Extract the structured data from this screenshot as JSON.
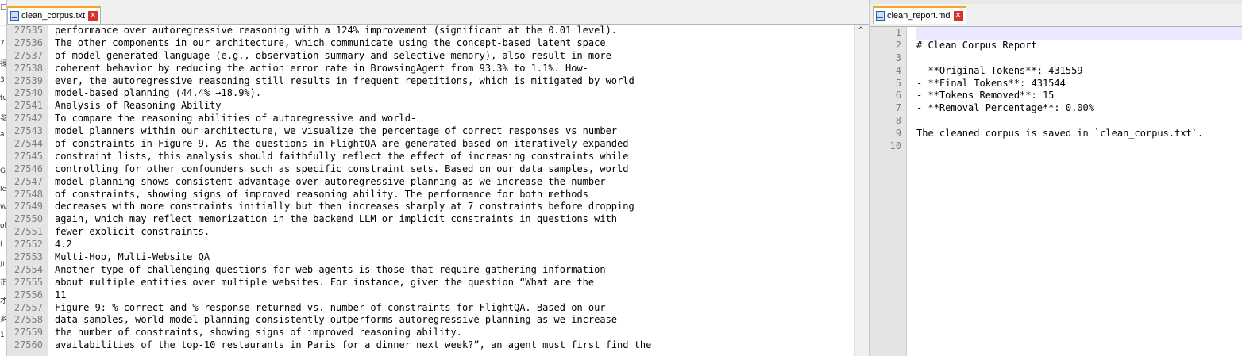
{
  "left_edge_glyphs": [
    "□",
    "—",
    "7",
    "禄",
    "3",
    "tu",
    "参",
    "a",
    "",
    "Gl",
    "le",
    "W",
    "ol",
    "(",
    "川",
    "正",
    "才",
    "乡",
    "1"
  ],
  "left_pane": {
    "tab": {
      "filename": "clean_corpus.txt",
      "close_glyph": "✕",
      "icon": "file-icon"
    },
    "lines": [
      {
        "n": "27535",
        "t": "performance over autoregressive reasoning with a 124% improvement (significant at the 0.01 level)."
      },
      {
        "n": "27536",
        "t": "The other components in our architecture, which communicate using the concept-based latent space"
      },
      {
        "n": "27537",
        "t": "of model-generated language (e.g., observation summary and selective memory), also result in more"
      },
      {
        "n": "27538",
        "t": "coherent behavior by reducing the action error rate in BrowsingAgent from 93.3% to 1.1%. How-"
      },
      {
        "n": "27539",
        "t": "ever, the autoregressive reasoning still results in frequent repetitions, which is mitigated by world"
      },
      {
        "n": "27540",
        "t": "model-based planning (44.4% →18.9%)."
      },
      {
        "n": "27541",
        "t": "Analysis of Reasoning Ability"
      },
      {
        "n": "27542",
        "t": "To compare the reasoning abilities of autoregressive and world-"
      },
      {
        "n": "27543",
        "t": "model planners within our architecture, we visualize the percentage of correct responses vs number"
      },
      {
        "n": "27544",
        "t": "of constraints in Figure 9. As the questions in FlightQA are generated based on iteratively expanded"
      },
      {
        "n": "27545",
        "t": "constraint lists, this analysis should faithfully reflect the effect of increasing constraints while"
      },
      {
        "n": "27546",
        "t": "controlling for other confounders such as specific constraint sets. Based on our data samples, world"
      },
      {
        "n": "27547",
        "t": "model planning shows consistent advantage over autoregressive planning as we increase the number"
      },
      {
        "n": "27548",
        "t": "of constraints, showing signs of improved reasoning ability. The performance for both methods"
      },
      {
        "n": "27549",
        "t": "decreases with more constraints initially but then increases sharply at 7 constraints before dropping"
      },
      {
        "n": "27550",
        "t": "again, which may reflect memorization in the backend LLM or implicit constraints in questions with"
      },
      {
        "n": "27551",
        "t": "fewer explicit constraints."
      },
      {
        "n": "27552",
        "t": "4.2"
      },
      {
        "n": "27553",
        "t": "Multi-Hop, Multi-Website QA"
      },
      {
        "n": "27554",
        "t": "Another type of challenging questions for web agents is those that require gathering information"
      },
      {
        "n": "27555",
        "t": "about multiple entities over multiple websites. For instance, given the question “What are the"
      },
      {
        "n": "27556",
        "t": "11"
      },
      {
        "n": "27557",
        "t": "Figure 9: % correct and % response returned vs. number of constraints for FlightQA. Based on our"
      },
      {
        "n": "27558",
        "t": "data samples, world model planning consistently outperforms autoregressive planning as we increase"
      },
      {
        "n": "27559",
        "t": "the number of constraints, showing signs of improved reasoning ability."
      },
      {
        "n": "27560",
        "t": "availabilities of the top-10 restaurants in Paris for a dinner next week?”, an agent must first find the"
      }
    ],
    "scroll_up_glyph": "^"
  },
  "right_pane": {
    "tab": {
      "filename": "clean_report.md",
      "close_glyph": "✕",
      "icon": "file-icon"
    },
    "lines": [
      {
        "n": "1",
        "t": ""
      },
      {
        "n": "2",
        "t": "# Clean Corpus Report"
      },
      {
        "n": "3",
        "t": ""
      },
      {
        "n": "4",
        "t": "- **Original Tokens**: 431559"
      },
      {
        "n": "5",
        "t": "- **Final Tokens**: 431544"
      },
      {
        "n": "6",
        "t": "- **Tokens Removed**: 15"
      },
      {
        "n": "7",
        "t": "- **Removal Percentage**: 0.00%"
      },
      {
        "n": "8",
        "t": ""
      },
      {
        "n": "9",
        "t": "The cleaned corpus is saved in `clean_corpus.txt`."
      },
      {
        "n": "10",
        "t": ""
      }
    ],
    "current_line_index": 0
  }
}
